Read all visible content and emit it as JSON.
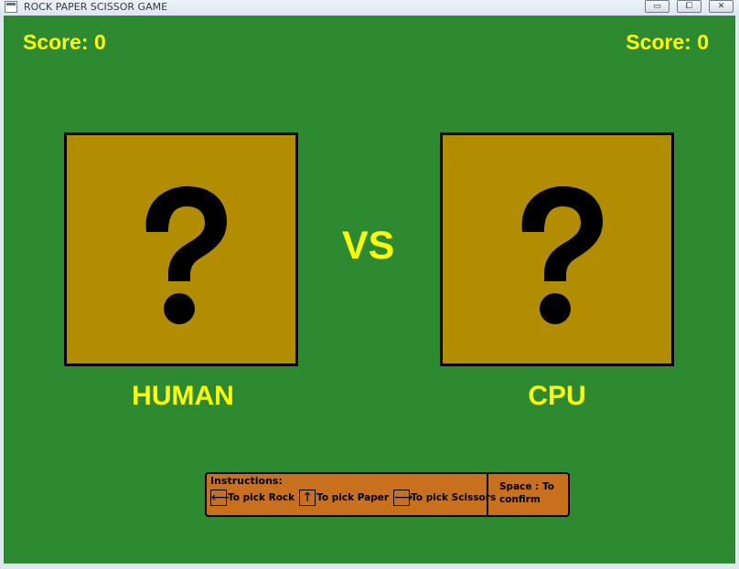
{
  "window": {
    "title": "ROCK PAPER SCISSOR GAME",
    "minimize_glyph": "▭",
    "maximize_glyph": "⧠",
    "close_glyph": "✕"
  },
  "scores": {
    "human": "Score: 0",
    "cpu": "Score: 0"
  },
  "arena": {
    "human_card_icon": "question-mark-icon",
    "cpu_card_icon": "question-mark-icon",
    "vs_text": "VS",
    "human_label": "HUMAN",
    "cpu_label": "CPU"
  },
  "instructions": {
    "title": "Instructions:",
    "items": [
      {
        "key_glyph": "⟵",
        "key_icon": "left-arrow-key-icon",
        "text": "To pick Rock"
      },
      {
        "key_glyph": "↑",
        "key_icon": "up-arrow-key-icon",
        "text": "To pick Paper"
      },
      {
        "key_glyph": "⟶",
        "key_icon": "right-arrow-key-icon",
        "text": "To pick Scissors"
      }
    ],
    "confirm_text": "Space : To confirm"
  },
  "colors": {
    "background": "#2d8a30",
    "card": "#b38d00",
    "text_accent": "#ffff00",
    "instructions_panel": "#c8701e"
  }
}
